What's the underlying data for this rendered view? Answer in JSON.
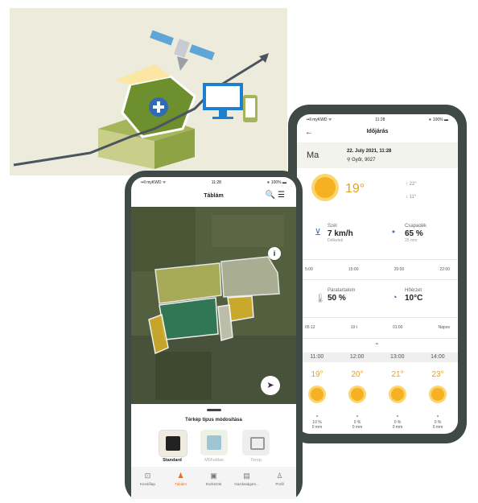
{
  "weather": {
    "status": {
      "carrier": "••ll myKWD ᯤ",
      "time": "11:28",
      "battery": "∗ 100% ▬"
    },
    "title": "Időjárás",
    "today_label": "Ma",
    "date": "22. July 2021, 11:28",
    "place": "Győr, 9027",
    "temp": "19°",
    "max": "↑ 22°",
    "min": "↓ 11°",
    "wind_label": "Szél",
    "wind_value": "7 km/h",
    "wind_sub": "Délkeleti",
    "humidity_label": "Csapadék",
    "humidity_value": "65 %",
    "humidity_sub": "25 mm",
    "small1": [
      "5:00",
      "15:00",
      "20:00",
      "22:00"
    ],
    "dew_label": "Páratartalom",
    "dew_value": "50 %",
    "feel_label": "Hőérzet",
    "feel_value": "10°C",
    "small2": [
      "05:12",
      "19 t",
      "01:00",
      "Napos"
    ],
    "hours": [
      "11:00",
      "12:00",
      "13:00",
      "14:00"
    ],
    "hour_temps": [
      "19°",
      "20°",
      "21°",
      "23°"
    ],
    "rain": [
      [
        "10 %",
        "0 mm"
      ],
      [
        "0 %",
        "0 mm"
      ],
      [
        "0 %",
        "0 mm"
      ],
      [
        "0 %",
        "0 mm"
      ]
    ]
  },
  "map_app": {
    "status": {
      "carrier": "••ll myKWD ᯤ",
      "time": "11:28",
      "battery": "∗ 100% ▬"
    },
    "title": "Táblám",
    "icons": "🔍 ☰",
    "info": "i",
    "nav": "➤",
    "add": "+",
    "sheet_title": "Térkép típus módosítása",
    "map_types": [
      "Standard",
      "Műholdas",
      "Terep"
    ],
    "tabs": [
      "Kezdőlap",
      "Táblám",
      "Eszközök",
      "Gazdaságom...",
      "Profil"
    ],
    "tab_icons": [
      "⊡",
      "♟",
      "▣",
      "▤",
      "♙"
    ]
  },
  "colors": {
    "accent": "#ef6a1f",
    "frame": "#3f4a47",
    "sun": "#f6b122",
    "field_green": "#5f8a2a"
  }
}
